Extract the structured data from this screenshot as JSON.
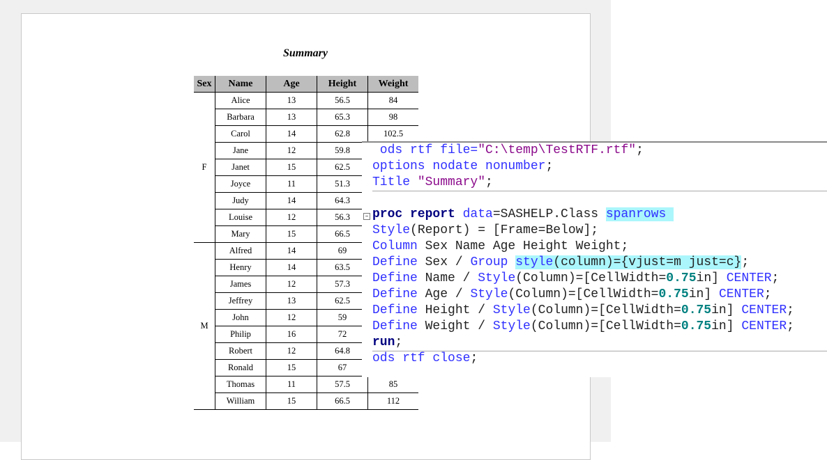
{
  "report": {
    "title": "Summary",
    "columns": [
      "Sex",
      "Name",
      "Age",
      "Height",
      "Weight"
    ],
    "groups": [
      {
        "sex": "F",
        "rows": [
          [
            "Alice",
            "13",
            "56.5",
            "84"
          ],
          [
            "Barbara",
            "13",
            "65.3",
            "98"
          ],
          [
            "Carol",
            "14",
            "62.8",
            "102.5"
          ],
          [
            "Jane",
            "12",
            "59.8",
            ""
          ],
          [
            "Janet",
            "15",
            "62.5",
            ""
          ],
          [
            "Joyce",
            "11",
            "51.3",
            ""
          ],
          [
            "Judy",
            "14",
            "64.3",
            ""
          ],
          [
            "Louise",
            "12",
            "56.3",
            ""
          ],
          [
            "Mary",
            "15",
            "66.5",
            ""
          ]
        ]
      },
      {
        "sex": "M",
        "rows": [
          [
            "Alfred",
            "14",
            "69",
            ""
          ],
          [
            "Henry",
            "14",
            "63.5",
            ""
          ],
          [
            "James",
            "12",
            "57.3",
            ""
          ],
          [
            "Jeffrey",
            "13",
            "62.5",
            ""
          ],
          [
            "John",
            "12",
            "59",
            ""
          ],
          [
            "Philip",
            "16",
            "72",
            ""
          ],
          [
            "Robert",
            "12",
            "64.8",
            ""
          ],
          [
            "Ronald",
            "15",
            "67",
            ""
          ],
          [
            "Thomas",
            "11",
            "57.5",
            "85"
          ],
          [
            "William",
            "15",
            "66.5",
            "112"
          ]
        ]
      }
    ]
  },
  "code": [
    [
      [
        " ods rtf file=",
        "kw"
      ],
      [
        "\"C:\\temp\\TestRTF.rtf\"",
        "str"
      ],
      [
        ";",
        "plain"
      ]
    ],
    [
      [
        "options nodate nonumber",
        "kw"
      ],
      [
        ";",
        "plain"
      ]
    ],
    [
      [
        "Title ",
        "kw"
      ],
      [
        "\"Summary\"",
        "str"
      ],
      [
        ";",
        "plain"
      ]
    ],
    null,
    [
      [
        "proc report",
        "bold"
      ],
      [
        " data",
        "kw"
      ],
      [
        "=SASHELP.Class ",
        "plain"
      ],
      [
        "spanrows ",
        "kw hl"
      ]
    ],
    [
      [
        "Style",
        "kw"
      ],
      [
        "(Report) = [Frame=Below];",
        "plain"
      ]
    ],
    [
      [
        "Column",
        "kw"
      ],
      [
        " Sex Name Age Height Weight;",
        "plain"
      ]
    ],
    [
      [
        "Define",
        "kw"
      ],
      [
        " Sex / ",
        "plain"
      ],
      [
        "Group ",
        "kw"
      ],
      [
        "style",
        "kw hl"
      ],
      [
        "(column)={vjust=m just=c}",
        "plain hl"
      ],
      [
        ";",
        "plain"
      ]
    ],
    [
      [
        "Define",
        "kw"
      ],
      [
        " Name / ",
        "plain"
      ],
      [
        "Style",
        "kw"
      ],
      [
        "(Column)=[CellWidth=",
        "plain"
      ],
      [
        "0.75",
        "num"
      ],
      [
        "in] ",
        "plain"
      ],
      [
        "CENTER",
        "kw"
      ],
      [
        ";",
        "plain"
      ]
    ],
    [
      [
        "Define",
        "kw"
      ],
      [
        " Age / ",
        "plain"
      ],
      [
        "Style",
        "kw"
      ],
      [
        "(Column)=[CellWidth=",
        "plain"
      ],
      [
        "0.75",
        "num"
      ],
      [
        "in] ",
        "plain"
      ],
      [
        "CENTER",
        "kw"
      ],
      [
        ";",
        "plain"
      ]
    ],
    [
      [
        "Define",
        "kw"
      ],
      [
        " Height / ",
        "plain"
      ],
      [
        "Style",
        "kw"
      ],
      [
        "(Column)=[CellWidth=",
        "plain"
      ],
      [
        "0.75",
        "num"
      ],
      [
        "in] ",
        "plain"
      ],
      [
        "CENTER",
        "kw"
      ],
      [
        ";",
        "plain"
      ]
    ],
    [
      [
        "Define",
        "kw"
      ],
      [
        " Weight / ",
        "plain"
      ],
      [
        "Style",
        "kw"
      ],
      [
        "(Column)=[CellWidth=",
        "plain"
      ],
      [
        "0.75",
        "num"
      ],
      [
        "in] ",
        "plain"
      ],
      [
        "CENTER",
        "kw"
      ],
      [
        ";",
        "plain"
      ]
    ],
    [
      [
        "run",
        "bold"
      ],
      [
        ";",
        "plain"
      ]
    ],
    [
      [
        "ods rtf close",
        "kw"
      ],
      [
        ";",
        "plain"
      ]
    ]
  ]
}
